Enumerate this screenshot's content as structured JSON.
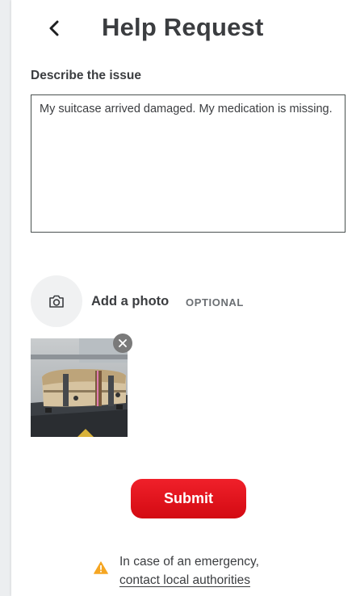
{
  "header": {
    "back_icon": "chevron-left-icon",
    "title": "Help Request"
  },
  "issue": {
    "label": "Describe the issue",
    "value": "My suitcase arrived damaged. My medication is missing."
  },
  "photo": {
    "icon": "camera-icon",
    "label": "Add a photo",
    "optional_tag": "OPTIONAL",
    "attachment_description_icon": "suitcase-photo",
    "remove_icon": "close-icon"
  },
  "actions": {
    "submit_label": "Submit",
    "submit_color": "#e8141c"
  },
  "notice": {
    "icon": "warning-icon",
    "icon_color": "#f5a623",
    "text": "In case of an emergency,",
    "link_text": "contact local authorities"
  }
}
